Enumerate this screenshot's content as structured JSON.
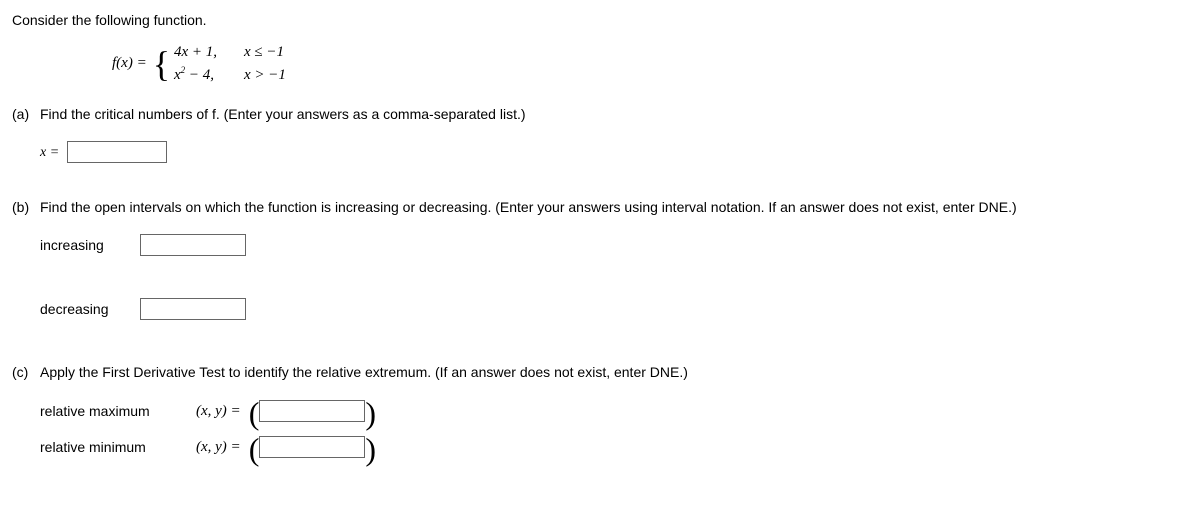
{
  "intro": "Consider the following function.",
  "function": {
    "lhs": "f(x) = ",
    "piece1_expr": "4x + 1,",
    "piece1_cond": "x ≤ −1",
    "piece2_expr_pre": "x",
    "piece2_expr_sup": "2",
    "piece2_expr_post": " − 4,",
    "piece2_cond": "x > −1"
  },
  "parts": {
    "a": {
      "label": "(a)",
      "prompt": "Find the critical numbers of f. (Enter your answers as a comma-separated list.)",
      "answer_label": "x ="
    },
    "b": {
      "label": "(b)",
      "prompt": "Find the open intervals on which the function is increasing or decreasing. (Enter your answers using interval notation. If an answer does not exist, enter DNE.)",
      "row1_label": "increasing",
      "row2_label": "decreasing"
    },
    "c": {
      "label": "(c)",
      "prompt": "Apply the First Derivative Test to identify the relative extremum. (If an answer does not exist, enter DNE.)",
      "row1_label": "relative maximum",
      "row2_label": "relative minimum",
      "xy_label": "(x, y)  ="
    }
  }
}
